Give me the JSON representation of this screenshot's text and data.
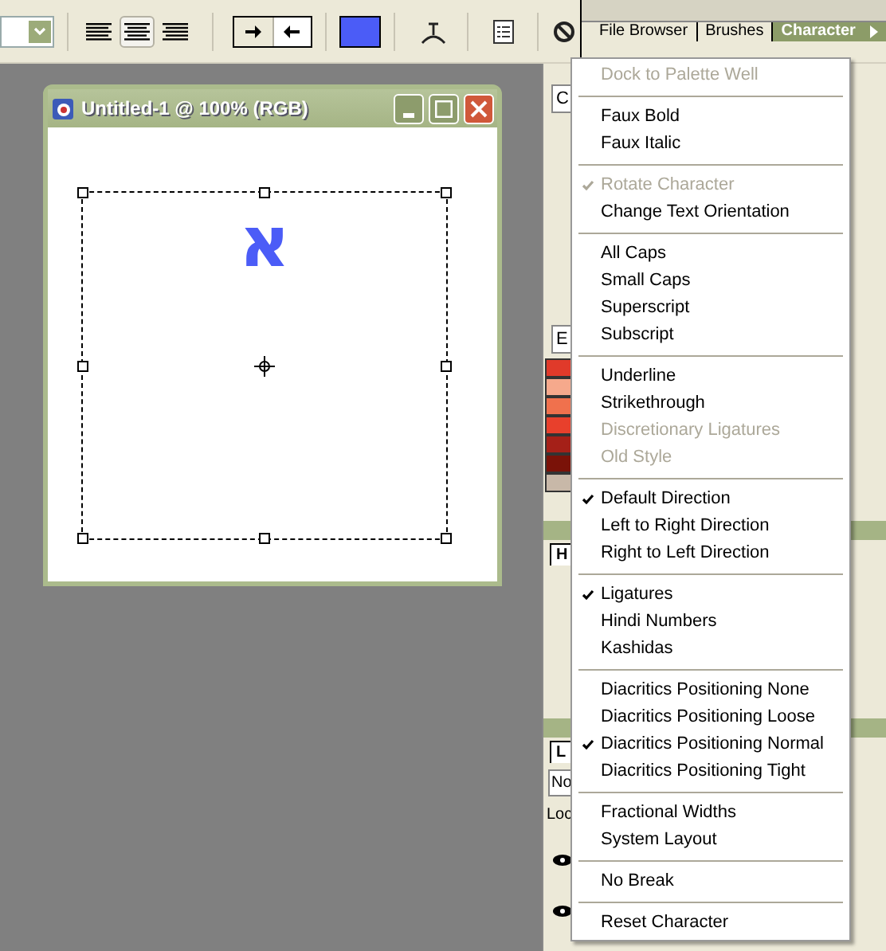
{
  "toolbar": {
    "align_buttons": [
      {
        "kind": "left",
        "selected": false
      },
      {
        "kind": "center",
        "selected": true
      },
      {
        "kind": "right",
        "selected": false
      }
    ],
    "direction_buttons": [
      {
        "kind": "ltr",
        "selected": false
      },
      {
        "kind": "rtl",
        "selected": true
      }
    ],
    "text_swatch": {
      "color": "#4b5cf7"
    }
  },
  "palette_tabs": [
    {
      "label": "File Browser",
      "selected": false
    },
    {
      "label": "Brushes",
      "selected": false
    },
    {
      "label": "Character",
      "selected": true
    }
  ],
  "document": {
    "title": "Untitled-1 @ 100% (RGB)",
    "text": "א"
  },
  "panel_fragments": {
    "character_field": "C",
    "swatch_field": "E",
    "history_tab": "H",
    "layers_tab": "L",
    "blend_mode": "No",
    "lock_label": "Loc"
  },
  "menu": [
    [
      {
        "label": "Dock to Palette Well",
        "checked": false,
        "disabled": true
      }
    ],
    [
      {
        "label": "Faux Bold",
        "checked": false,
        "disabled": false
      },
      {
        "label": "Faux Italic",
        "checked": false,
        "disabled": false
      }
    ],
    [
      {
        "label": "Rotate Character",
        "checked": true,
        "disabled": true
      },
      {
        "label": "Change Text Orientation",
        "checked": false,
        "disabled": false
      }
    ],
    [
      {
        "label": "All Caps",
        "checked": false,
        "disabled": false
      },
      {
        "label": "Small Caps",
        "checked": false,
        "disabled": false
      },
      {
        "label": "Superscript",
        "checked": false,
        "disabled": false
      },
      {
        "label": "Subscript",
        "checked": false,
        "disabled": false
      }
    ],
    [
      {
        "label": "Underline",
        "checked": false,
        "disabled": false
      },
      {
        "label": "Strikethrough",
        "checked": false,
        "disabled": false
      },
      {
        "label": "Discretionary Ligatures",
        "checked": false,
        "disabled": true
      },
      {
        "label": "Old Style",
        "checked": false,
        "disabled": true
      }
    ],
    [
      {
        "label": "Default Direction",
        "checked": true,
        "disabled": false
      },
      {
        "label": "Left to Right Direction",
        "checked": false,
        "disabled": false
      },
      {
        "label": "Right to Left Direction",
        "checked": false,
        "disabled": false
      }
    ],
    [
      {
        "label": "Ligatures",
        "checked": true,
        "disabled": false
      },
      {
        "label": "Hindi Numbers",
        "checked": false,
        "disabled": false
      },
      {
        "label": "Kashidas",
        "checked": false,
        "disabled": false
      }
    ],
    [
      {
        "label": "Diacritics Positioning None",
        "checked": false,
        "disabled": false
      },
      {
        "label": "Diacritics Positioning Loose",
        "checked": false,
        "disabled": false
      },
      {
        "label": "Diacritics Positioning Normal",
        "checked": true,
        "disabled": false
      },
      {
        "label": "Diacritics Positioning Tight",
        "checked": false,
        "disabled": false
      }
    ],
    [
      {
        "label": "Fractional Widths",
        "checked": false,
        "disabled": false
      },
      {
        "label": "System Layout",
        "checked": false,
        "disabled": false
      }
    ],
    [
      {
        "label": "No Break",
        "checked": false,
        "disabled": false
      }
    ],
    [
      {
        "label": "Reset Character",
        "checked": false,
        "disabled": false
      }
    ]
  ]
}
